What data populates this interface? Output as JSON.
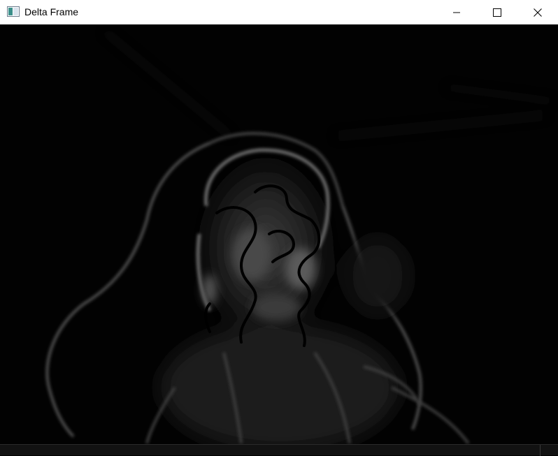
{
  "window": {
    "title": "Delta Frame"
  },
  "titlebar": {
    "app_icon": "opencv-window-icon",
    "minimize_icon": "minimize-icon",
    "maximize_icon": "maximize-icon",
    "close_icon": "close-icon"
  },
  "canvas": {
    "content": "delta-frame-image",
    "colors": {
      "background": "#020202",
      "edge": "#5a5a5a",
      "highlight": "#8a8a8a"
    }
  },
  "statusbar": {
    "text": ""
  }
}
